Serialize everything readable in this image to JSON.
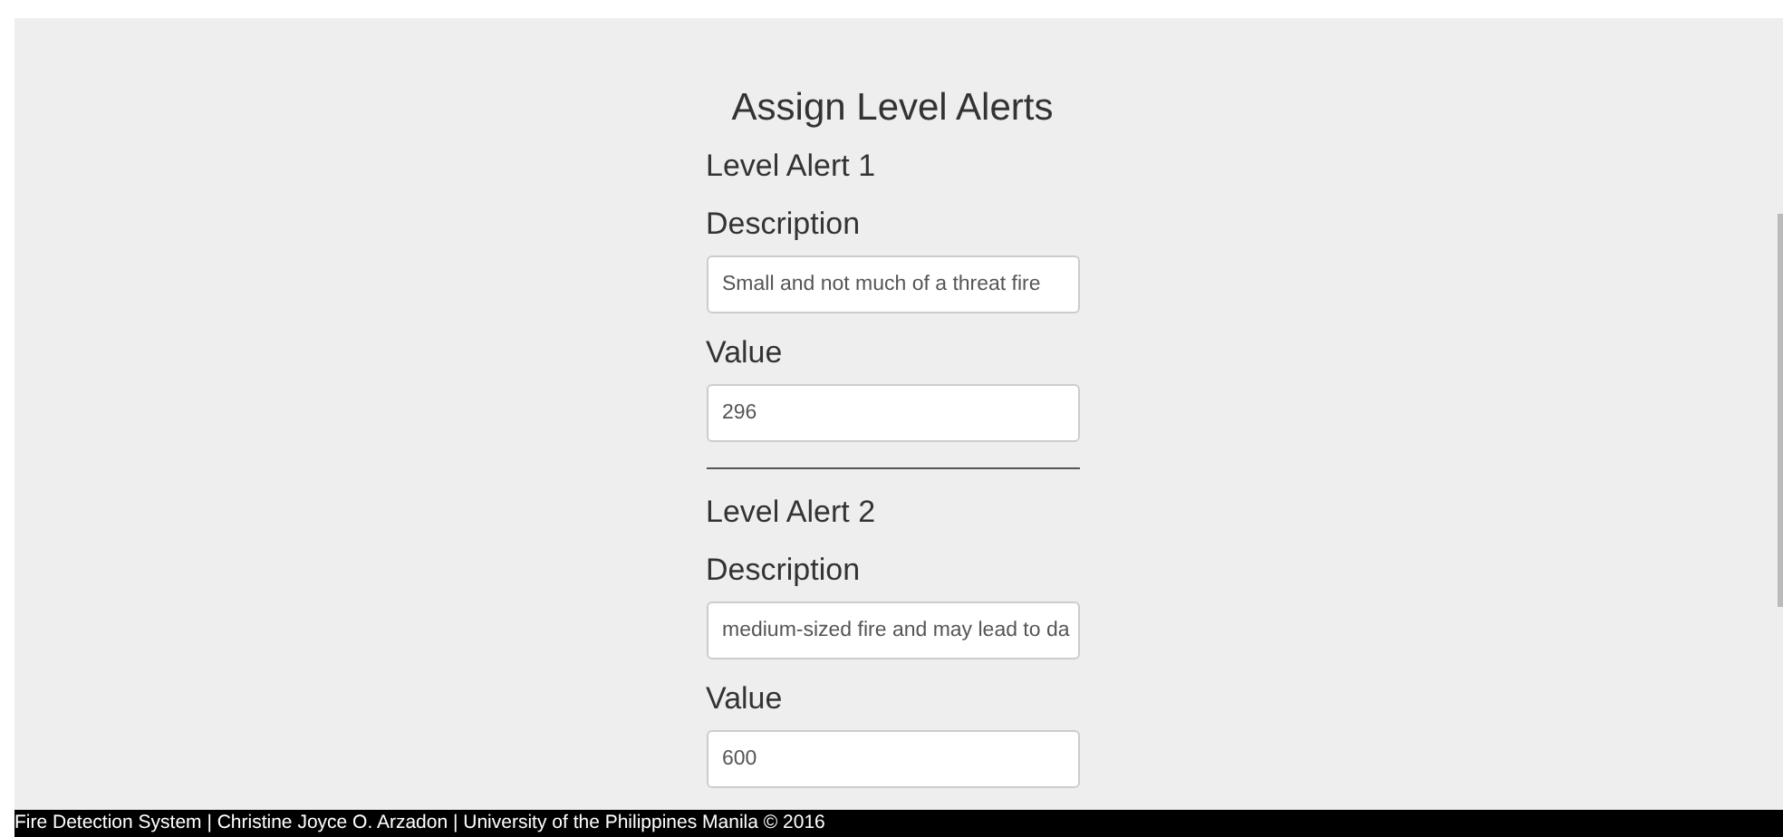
{
  "title": "Assign Level Alerts",
  "alerts": [
    {
      "heading": "Level Alert 1",
      "description_label": "Description",
      "description": "Small and not much of a threat fire",
      "value_label": "Value",
      "value": "296"
    },
    {
      "heading": "Level Alert 2",
      "description_label": "Description",
      "description": "medium-sized fire and may lead to da",
      "value_label": "Value",
      "value": "600"
    }
  ],
  "footer": "Fire Detection System | Christine Joyce O. Arzadon | University of the Philippines Manila © 2016"
}
